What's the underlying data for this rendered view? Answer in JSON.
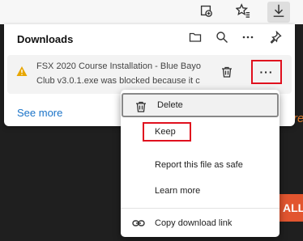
{
  "toolbar": {
    "icons": [
      "extensions-icon",
      "favorites-icon",
      "downloads-icon"
    ]
  },
  "background": {
    "italic_fragment": "re",
    "bar_fragment": "ALL",
    "accent_orange": "#e07a2c",
    "accent_red": "#e2552f"
  },
  "downloads": {
    "title": "Downloads",
    "header_icons": [
      "folder-icon",
      "search-icon",
      "more-icon",
      "pin-icon"
    ],
    "item": {
      "line1": "FSX 2020 Course Installation - Blue Bayo",
      "line2": "Club v3.0.1.exe was blocked because it c",
      "more_label": "···"
    },
    "see_more": "See more",
    "link_color": "#1a73c8"
  },
  "menu": {
    "delete": "Delete",
    "keep": "Keep",
    "report": "Report this file as safe",
    "learn": "Learn more",
    "copy": "Copy download link"
  },
  "highlight_color": "#e0101e"
}
